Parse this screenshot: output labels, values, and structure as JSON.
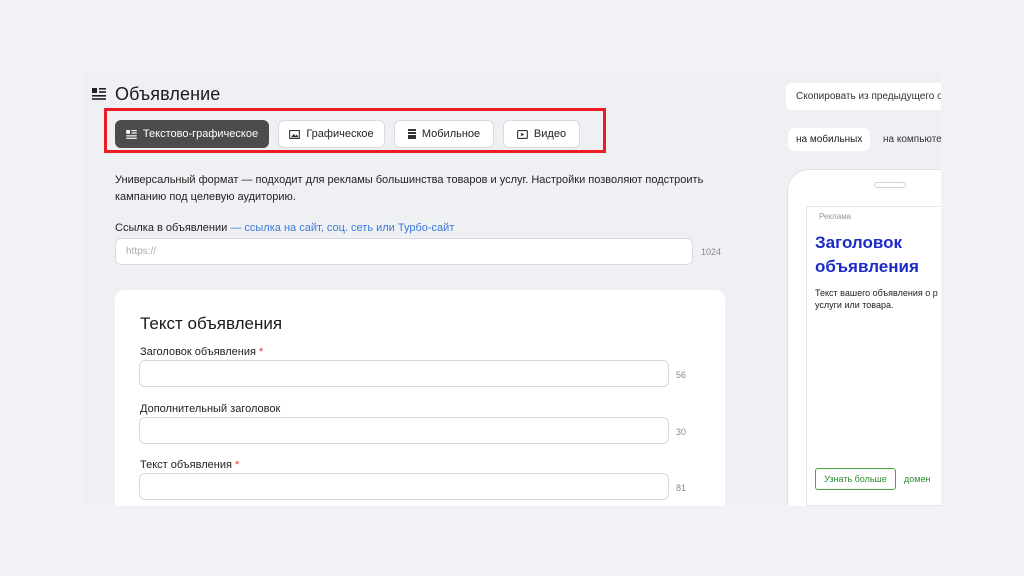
{
  "header": {
    "title": "Объявление",
    "icon": "list-icon"
  },
  "tabs": [
    {
      "label": "Текстово-графическое",
      "icon": "text-graphic-icon",
      "active": true
    },
    {
      "label": "Графическое",
      "icon": "image-icon",
      "active": false
    },
    {
      "label": "Мобильное",
      "icon": "mobile-icon",
      "active": false
    },
    {
      "label": "Видео",
      "icon": "video-icon",
      "active": false
    }
  ],
  "description": {
    "line1": "Универсальный формат — подходит для рекламы большинства товаров и услуг. Настройки позволяют подстроить",
    "line2": "кампанию под целевую аудиторию."
  },
  "link": {
    "label": "Ссылка в объявлении",
    "hint": " — ссылка на сайт, соц. сеть или Турбо-сайт",
    "placeholder": "https://",
    "counter": "1024"
  },
  "ad_text_card": {
    "title": "Текст объявления",
    "fields": [
      {
        "label": "Заголовок объявления",
        "required": "*",
        "counter": "56"
      },
      {
        "label": "Дополнительный заголовок",
        "required": "",
        "counter": "30"
      },
      {
        "label": "Текст объявления",
        "required": "*",
        "counter": "81"
      }
    ]
  },
  "preview": {
    "copy_button": "Скопировать из предыдущего о",
    "device_tabs": [
      "на мобильных",
      "на компьюте"
    ],
    "ad_label": "Реклама",
    "ad_title": "Заголовок объявления",
    "ad_text": "Текст вашего объявления о р услуги или товара.",
    "cta": "Узнать больше",
    "domain": "домен"
  },
  "colors": {
    "highlight_frame": "#ee1b24",
    "active_tab": "#4c4c4c",
    "ad_title": "#1c2bc7",
    "cta_green": "#2e8b34",
    "link_blue": "#3b7ad9"
  }
}
